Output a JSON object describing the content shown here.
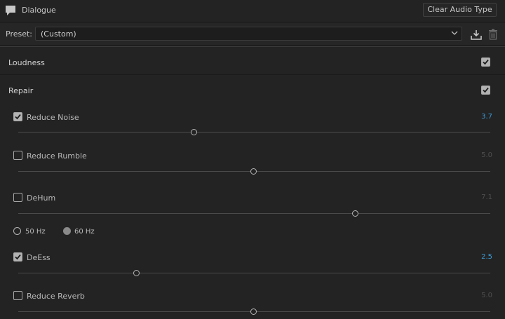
{
  "header": {
    "title": "Dialogue",
    "clear_button": "Clear Audio Type",
    "icon": "speech-bubble-icon"
  },
  "preset": {
    "label": "Preset:",
    "value": "(Custom)",
    "save_icon": "save-preset-icon",
    "delete_icon": "trash-icon"
  },
  "sections": {
    "loudness": {
      "label": "Loudness",
      "checked": true
    },
    "repair": {
      "label": "Repair",
      "checked": true
    }
  },
  "controls": {
    "reduce_noise": {
      "label": "Reduce Noise",
      "checked": true,
      "value": "3.7",
      "level": 0.37
    },
    "reduce_rumble": {
      "label": "Reduce Rumble",
      "checked": false,
      "value": "5.0",
      "level": 0.5
    },
    "dehum": {
      "label": "DeHum",
      "checked": false,
      "value": "7.1",
      "level": 0.71
    },
    "deess": {
      "label": "DeEss",
      "checked": true,
      "value": "2.5",
      "level": 0.25
    },
    "reduce_reverb": {
      "label": "Reduce Reverb",
      "checked": false,
      "value": "5.0",
      "level": 0.5
    }
  },
  "hum": {
    "option_50": "50 Hz",
    "option_60": "60 Hz",
    "selected": "60 Hz"
  },
  "colors": {
    "accent_value": "#3d9ad6",
    "background": "#232323"
  }
}
